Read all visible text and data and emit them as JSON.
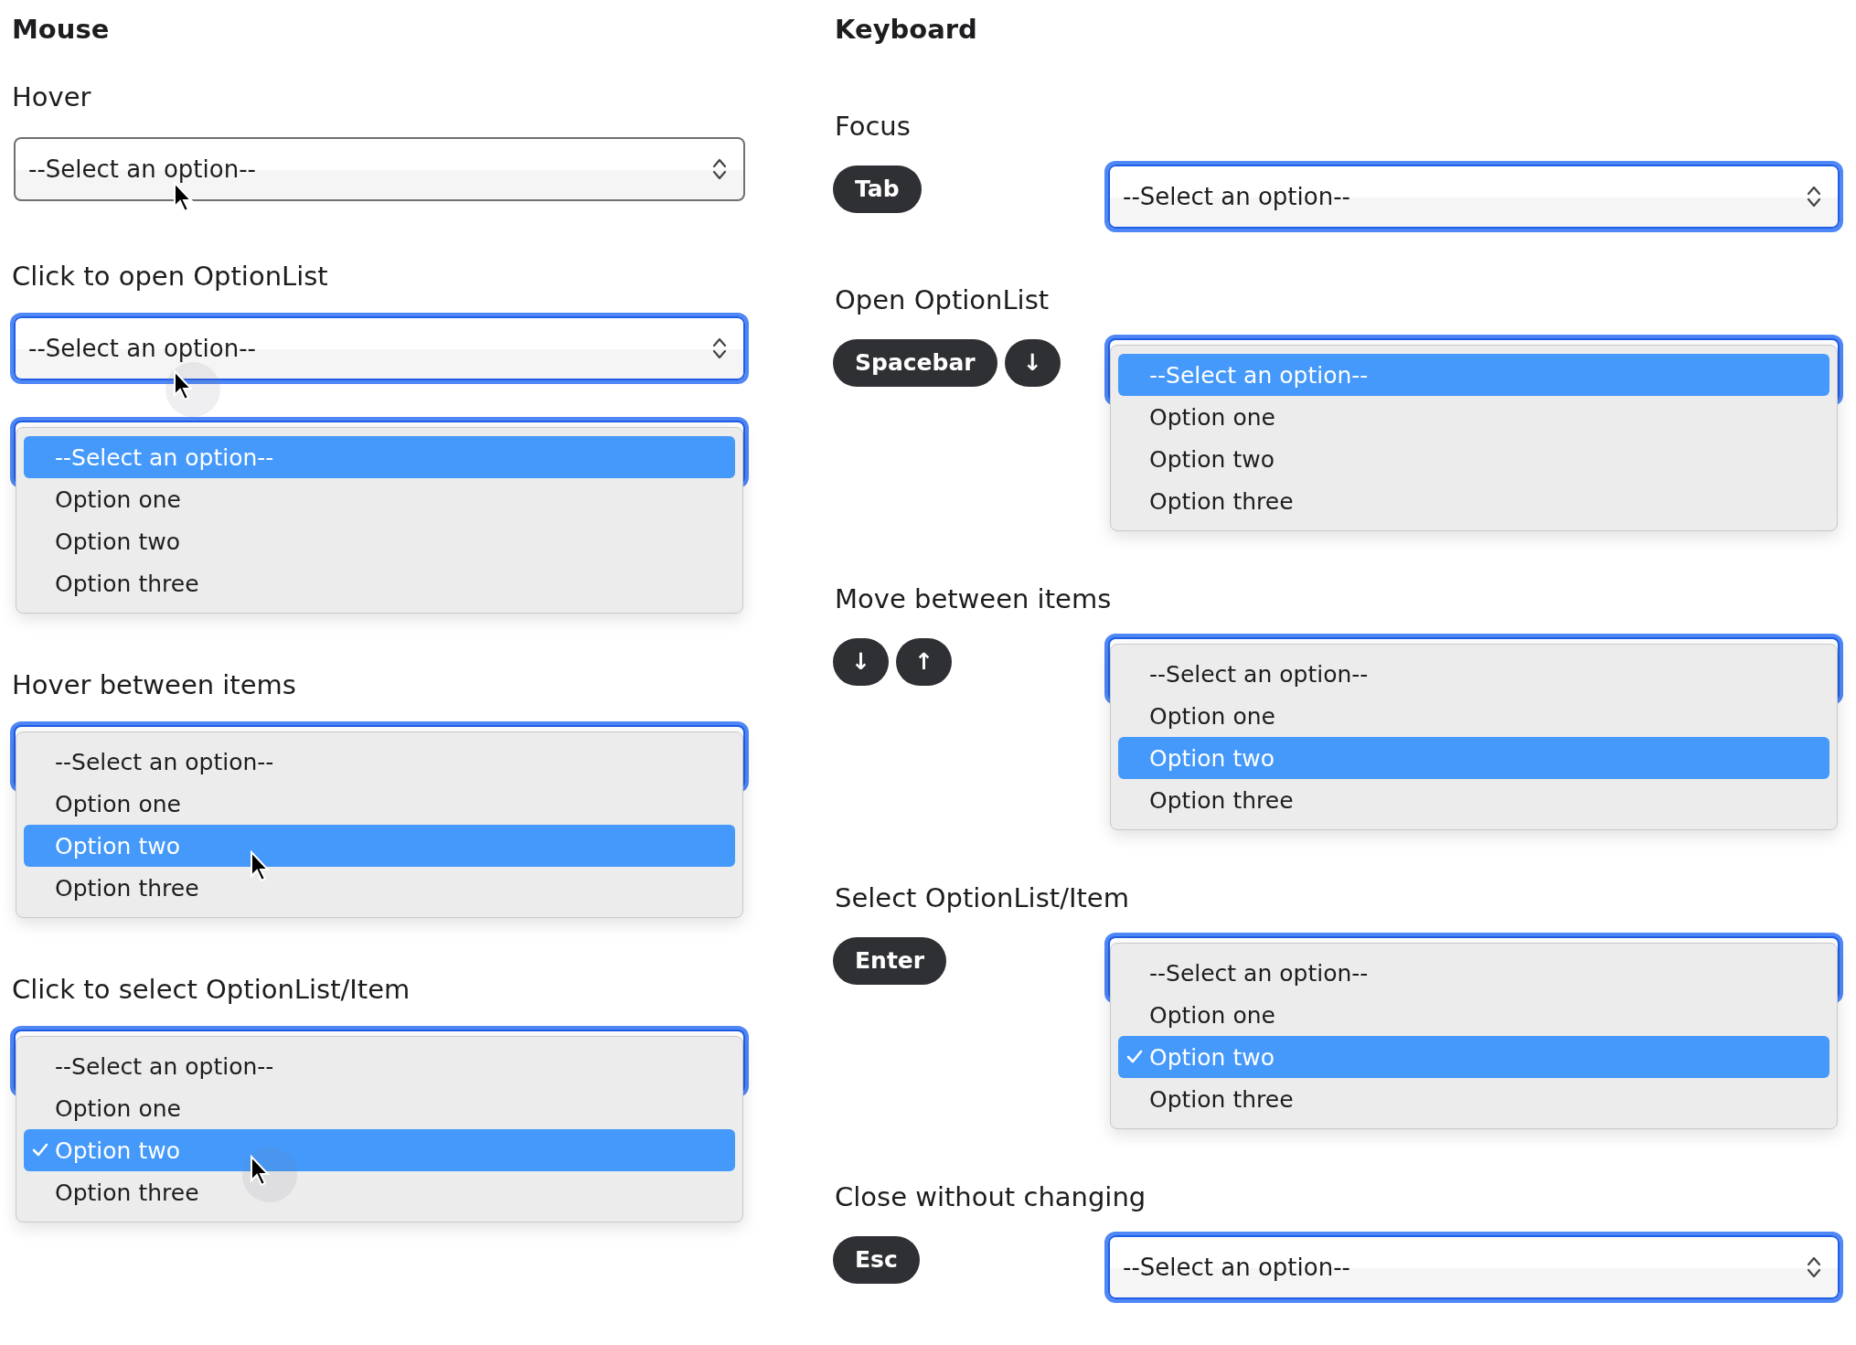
{
  "columns": [
    {
      "title": "Mouse",
      "sections": [
        {
          "label": "Hover",
          "controls": [
            {
              "kind": "select",
              "focused": false,
              "value": "--Select an option--",
              "pointer": true,
              "clicked": false
            }
          ]
        },
        {
          "label": "Click to open OptionList",
          "controls": [
            {
              "kind": "select",
              "focused": true,
              "value": "--Select an option--",
              "pointer": true,
              "clicked": true
            },
            {
              "kind": "list",
              "pointer": false,
              "options": [
                {
                  "label": "--Select an option--",
                  "highlighted": true,
                  "checked": false
                },
                {
                  "label": "Option one",
                  "highlighted": false,
                  "checked": false
                },
                {
                  "label": "Option two",
                  "highlighted": false,
                  "checked": false
                },
                {
                  "label": "Option three",
                  "highlighted": false,
                  "checked": false
                }
              ]
            }
          ]
        },
        {
          "label": "Hover between items",
          "controls": [
            {
              "kind": "list",
              "pointer": true,
              "clicked": false,
              "options": [
                {
                  "label": "--Select an option--",
                  "highlighted": false,
                  "checked": false
                },
                {
                  "label": "Option one",
                  "highlighted": false,
                  "checked": false
                },
                {
                  "label": "Option two",
                  "highlighted": true,
                  "checked": false
                },
                {
                  "label": "Option three",
                  "highlighted": false,
                  "checked": false
                }
              ]
            }
          ]
        },
        {
          "label": "Click to select OptionList/Item",
          "controls": [
            {
              "kind": "list",
              "pointer": true,
              "clicked": true,
              "options": [
                {
                  "label": "--Select an option--",
                  "highlighted": false,
                  "checked": false
                },
                {
                  "label": "Option one",
                  "highlighted": false,
                  "checked": false
                },
                {
                  "label": "Option two",
                  "highlighted": true,
                  "checked": true
                },
                {
                  "label": "Option three",
                  "highlighted": false,
                  "checked": false
                }
              ]
            }
          ]
        }
      ]
    },
    {
      "title": "Keyboard",
      "sections": [
        {
          "label": "Focus",
          "keys": [
            "Tab"
          ],
          "controls": [
            {
              "kind": "select",
              "focused": true,
              "value": "--Select an option--",
              "pointer": false
            }
          ]
        },
        {
          "label": "Open OptionList",
          "keys": [
            "Spacebar",
            "↓"
          ],
          "controls": [
            {
              "kind": "list",
              "pointer": false,
              "options": [
                {
                  "label": "--Select an option--",
                  "highlighted": true,
                  "checked": false
                },
                {
                  "label": "Option one",
                  "highlighted": false,
                  "checked": false
                },
                {
                  "label": "Option two",
                  "highlighted": false,
                  "checked": false
                },
                {
                  "label": "Option three",
                  "highlighted": false,
                  "checked": false
                }
              ]
            }
          ]
        },
        {
          "label": "Move between items",
          "keys": [
            "↓",
            "↑"
          ],
          "controls": [
            {
              "kind": "list",
              "pointer": false,
              "options": [
                {
                  "label": "--Select an option--",
                  "highlighted": false,
                  "checked": false
                },
                {
                  "label": "Option one",
                  "highlighted": false,
                  "checked": false
                },
                {
                  "label": "Option two",
                  "highlighted": true,
                  "checked": false
                },
                {
                  "label": "Option three",
                  "highlighted": false,
                  "checked": false
                }
              ]
            }
          ]
        },
        {
          "label": "Select OptionList/Item",
          "keys": [
            "Enter"
          ],
          "controls": [
            {
              "kind": "list",
              "pointer": false,
              "options": [
                {
                  "label": "--Select an option--",
                  "highlighted": false,
                  "checked": false
                },
                {
                  "label": "Option one",
                  "highlighted": false,
                  "checked": false
                },
                {
                  "label": "Option two",
                  "highlighted": true,
                  "checked": true
                },
                {
                  "label": "Option three",
                  "highlighted": false,
                  "checked": false
                }
              ]
            }
          ]
        },
        {
          "label": "Close without changing",
          "keys": [
            "Esc"
          ],
          "controls": [
            {
              "kind": "select",
              "focused": true,
              "value": "--Select an option--",
              "pointer": false
            }
          ]
        }
      ]
    }
  ]
}
